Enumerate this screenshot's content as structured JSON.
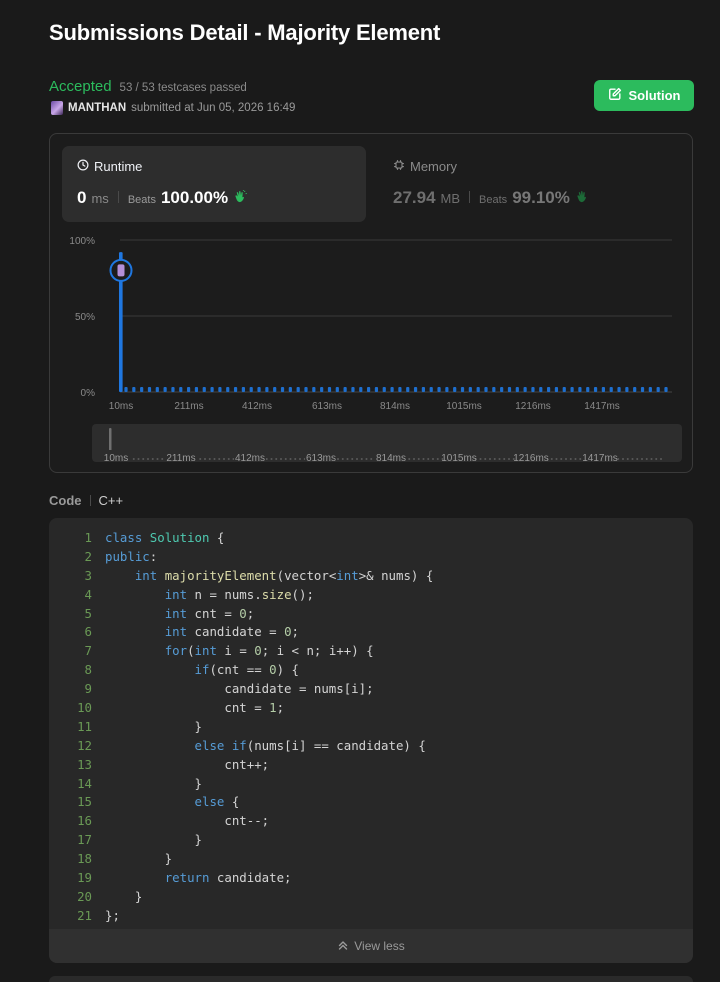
{
  "page": {
    "title": "Submissions Detail - Majority Element"
  },
  "status": {
    "result": "Accepted",
    "testcases": "53 / 53 testcases passed",
    "username": "MANTHAN",
    "submitted_text": "submitted at Jun 05, 2026 16:49",
    "accent_color": "#2cbb5d"
  },
  "solution_button": {
    "label": "Solution",
    "icon": "edit-icon"
  },
  "runtime_tab": {
    "label": "Runtime",
    "icon": "clock-icon",
    "value": "0",
    "unit": "ms",
    "beats_label": "Beats",
    "beats_value": "100.00%",
    "beats_icon": "clap-hands-icon"
  },
  "memory_tab": {
    "label": "Memory",
    "icon": "chip-icon",
    "value": "27.94",
    "unit": "MB",
    "beats_label": "Beats",
    "beats_value": "99.10%",
    "beats_icon": "clap-hands-icon"
  },
  "chart_data": {
    "type": "bar",
    "y_tick_labels": [
      "100%",
      "50%",
      "0%"
    ],
    "ylim": [
      0,
      100
    ],
    "x_tick_labels": [
      "10ms",
      "211ms",
      "412ms",
      "613ms",
      "814ms",
      "1015ms",
      "1216ms",
      "1417ms"
    ],
    "bar_color": "#1e6fcf",
    "highlight_bar_value_percent": 92,
    "user_marker_percent": 80,
    "small_bar_count": 70,
    "grid": true
  },
  "range_slider": {
    "tick_labels": [
      "10ms",
      "211ms",
      "412ms",
      "613ms",
      "814ms",
      "1015ms",
      "1216ms",
      "1417ms"
    ]
  },
  "code_section": {
    "label": "Code",
    "language": "C++",
    "lines": [
      "class Solution {",
      "public:",
      "    int majorityElement(vector<int>& nums) {",
      "        int n = nums.size();",
      "        int cnt = 0;",
      "        int candidate = 0;",
      "        for(int i = 0; i < n; i++) {",
      "            if(cnt == 0) {",
      "                candidate = nums[i];",
      "                cnt = 1;",
      "            }",
      "            else if(nums[i] == candidate) {",
      "                cnt++;",
      "            }",
      "            else {",
      "                cnt--;",
      "            }",
      "        }",
      "        return candidate;",
      "    }",
      "};"
    ],
    "view_less_label": "View less",
    "view_less_icon": "double-chevron-up-icon"
  }
}
